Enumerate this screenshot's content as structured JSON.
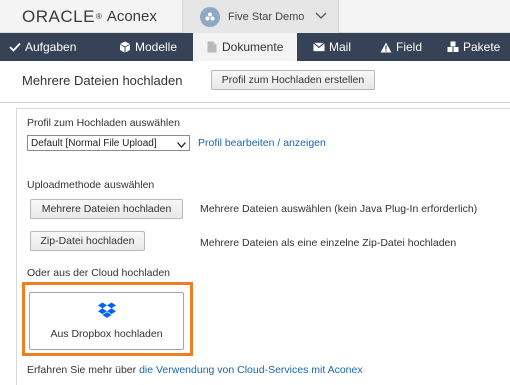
{
  "brand": {
    "oracle": "ORACLE",
    "aconex": "Aconex"
  },
  "project": {
    "name": "Five Star Demo"
  },
  "nav": {
    "items": [
      {
        "label": "Aufgaben"
      },
      {
        "label": "Modelle"
      },
      {
        "label": "Dokumente"
      },
      {
        "label": "Mail"
      },
      {
        "label": "Field"
      },
      {
        "label": "Pakete"
      }
    ]
  },
  "page": {
    "title": "Mehrere Dateien hochladen",
    "profile_button": "Profil zum Hochladen erstellen"
  },
  "profile": {
    "label": "Profil zum Hochladen auswählen",
    "selected": "Default [Normal File Upload]",
    "edit_link": "Profil bearbeiten / anzeigen"
  },
  "upload_method": {
    "label": "Uploadmethode auswählen",
    "multi_button": "Mehrere Dateien hochladen",
    "multi_desc": "Mehrere Dateien auswählen (kein Java Plug-In erforderlich)",
    "zip_button": "Zip-Datei hochladen",
    "zip_desc": "Mehrere Dateien als eine einzelne Zip-Datei hochladen"
  },
  "cloud": {
    "label": "Oder aus der Cloud hochladen",
    "dropbox_button": "Aus Dropbox hochladen",
    "info_prefix": "Erfahren Sie mehr über",
    "info_link": "die Verwendung von Cloud-Services mit Aconex"
  },
  "colors": {
    "nav_bg": "#364255",
    "highlight_border": "#ef7d22",
    "link": "#1a66b3",
    "dropbox_blue": "#0061fe"
  }
}
